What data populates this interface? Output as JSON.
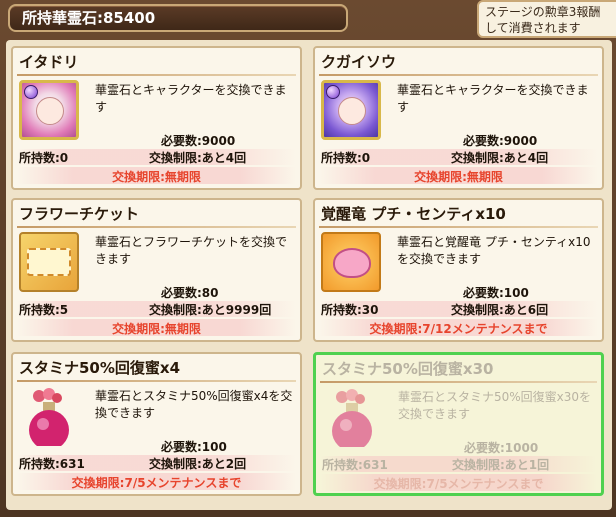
{
  "header": {
    "owned_stones": "所持華霊石:85400"
  },
  "notice": {
    "line1": "ステージの勲章3報酬",
    "line2": "して消費されます"
  },
  "cards": [
    {
      "title": "イタドリ",
      "desc": "華霊石とキャラクターを交換できます",
      "required": "必要数:9000",
      "limit": "交換制限:あと4回",
      "owned": "所持数:0",
      "period": "交換期限:無期限",
      "icon": "character-itadori-icon"
    },
    {
      "title": "クガイソウ",
      "desc": "華霊石とキャラクターを交換できます",
      "required": "必要数:9000",
      "limit": "交換制限:あと4回",
      "owned": "所持数:0",
      "period": "交換期限:無期限",
      "icon": "character-kugaisou-icon"
    },
    {
      "title": "フラワーチケット",
      "desc": "華霊石とフラワーチケットを交換できます",
      "required": "必要数:80",
      "limit": "交換制限:あと9999回",
      "owned": "所持数:5",
      "period": "交換期限:無期限",
      "icon": "flower-ticket-icon"
    },
    {
      "title": "覚醒竜 プチ・センティx10",
      "desc": "華霊石と覚醒竜 プチ・センティx10を交換できます",
      "required": "必要数:100",
      "limit": "交換制限:あと6回",
      "owned": "所持数:30",
      "period": "交換期限:7/12メンテナンスまで",
      "icon": "awakening-dragon-icon"
    },
    {
      "title": "スタミナ50%回復蜜x4",
      "desc": "華霊石とスタミナ50%回復蜜x4を交換できます",
      "required": "必要数:100",
      "limit": "交換制限:あと2回",
      "owned": "所持数:631",
      "period": "交換期限:7/5メンテナンスまで",
      "icon": "stamina-honey-icon"
    },
    {
      "title": "スタミナ50%回復蜜x30",
      "desc": "華霊石とスタミナ50%回復蜜x30を交換できます",
      "required": "必要数:1000",
      "limit": "交換制限:あと1回",
      "owned": "所持数:631",
      "period": "交換期限:7/5メンテナンスまで",
      "icon": "stamina-honey-icon"
    }
  ]
}
